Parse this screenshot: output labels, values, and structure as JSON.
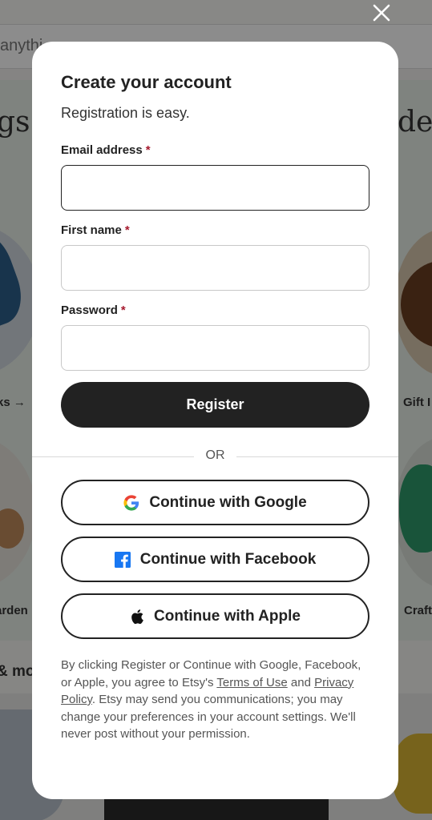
{
  "background": {
    "search_placeholder": "anythi",
    "heading_left": "gs",
    "heading_right": "de",
    "captions": [
      "ks →",
      "Gift I",
      "arden",
      "Craft"
    ],
    "strip_text": "& mo"
  },
  "modal": {
    "title": "Create your account",
    "subtitle": "Registration is easy.",
    "fields": {
      "email": {
        "label": "Email address",
        "required_mark": "*",
        "value": "",
        "placeholder": ""
      },
      "first_name": {
        "label": "First name",
        "required_mark": "*",
        "value": "",
        "placeholder": ""
      },
      "password": {
        "label": "Password",
        "required_mark": "*",
        "value": "",
        "placeholder": ""
      }
    },
    "register_label": "Register",
    "divider_text": "OR",
    "social": {
      "google": {
        "label": "Continue with Google",
        "icon": "google-icon"
      },
      "facebook": {
        "label": "Continue with Facebook",
        "icon": "facebook-icon"
      },
      "apple": {
        "label": "Continue with Apple",
        "icon": "apple-icon"
      }
    },
    "legal": {
      "part1": "By clicking Register or Continue with Google, Facebook, or Apple, you agree to Etsy's ",
      "terms_link": "Terms of Use",
      "part2": " and ",
      "privacy_link": "Privacy Policy",
      "part3": ". Etsy may send you communications; you may change your preferences in your account settings. We'll never post without your permission."
    }
  },
  "colors": {
    "required": "#a61a2e",
    "primary_button": "#222222",
    "facebook_blue": "#1877f2"
  },
  "close_icon": "close-icon"
}
